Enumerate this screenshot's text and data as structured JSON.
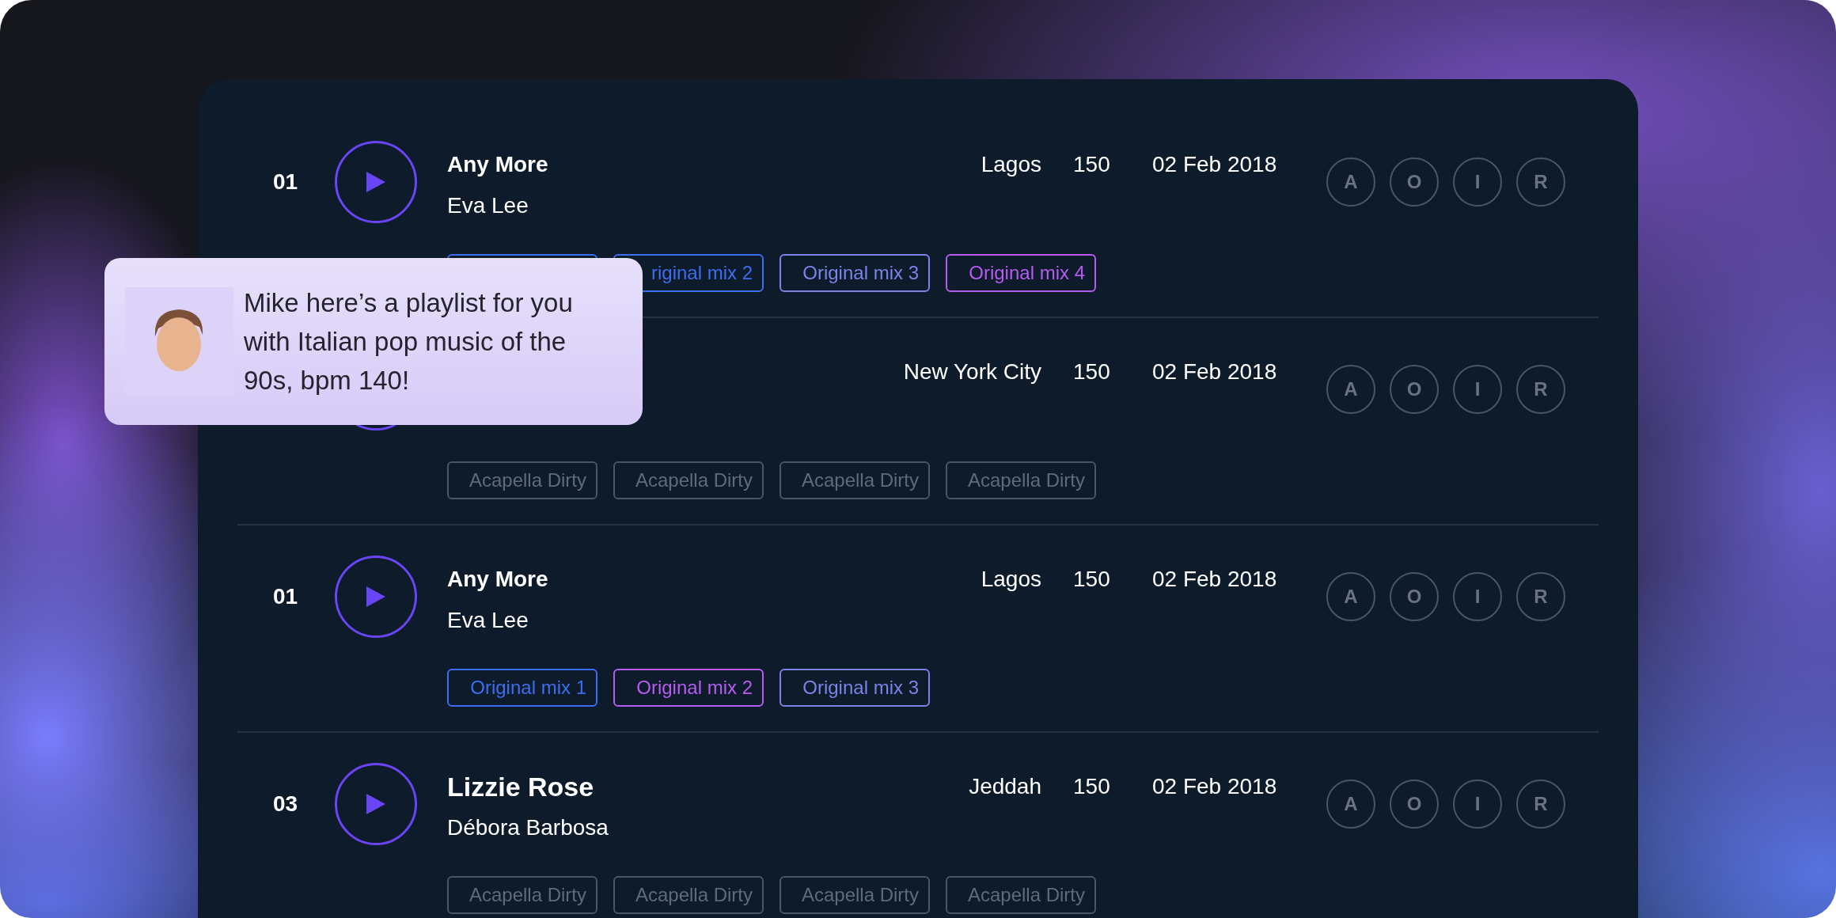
{
  "tracks": [
    {
      "kind": "regular",
      "number": "01",
      "title": "Any More",
      "artist": "Eva Lee",
      "location": "Lagos",
      "bpm": "150",
      "date": "02 Feb 2018",
      "badges": [
        "A",
        "O",
        "I",
        "R"
      ],
      "tags": [
        {
          "color": "#3b6ef0"
        },
        {
          "label": "riginal mix 2",
          "color": "#3b6ef0"
        },
        {
          "label": "Original mix 3",
          "color": "#7b83e8"
        },
        {
          "label": "Original mix 4",
          "color": "#b65cf0"
        }
      ]
    },
    {
      "location": "New York City",
      "bpm": "150",
      "date": "02 Feb 2018",
      "badges": [
        "A",
        "O",
        "I",
        "R"
      ],
      "tags": [
        {
          "label": "Acapella Dirty",
          "color": "#4b5563"
        },
        {
          "label": "Acapella Dirty",
          "color": "#4b5563"
        },
        {
          "label": "Acapella Dirty",
          "color": "#4b5563"
        },
        {
          "label": "Acapella Dirty",
          "color": "#4b5563"
        }
      ]
    },
    {
      "kind": "regular",
      "number": "01",
      "title": "Any More",
      "artist": "Eva Lee",
      "location": "Lagos",
      "bpm": "150",
      "date": "02 Feb 2018",
      "badges": [
        "A",
        "O",
        "I",
        "R"
      ],
      "tags": [
        {
          "label": "Original mix 1",
          "color": "#3b6ef0"
        },
        {
          "label": "Original mix 2",
          "color": "#b65cf0"
        },
        {
          "label": "Original mix 3",
          "color": "#7b83e8"
        }
      ]
    },
    {
      "kind": "large",
      "number": "03",
      "title": "Lizzie Rose",
      "artist": "Débora Barbosa",
      "location": "Jeddah",
      "bpm": "150",
      "date": "02 Feb 2018",
      "badges": [
        "A",
        "O",
        "I",
        "R"
      ],
      "tags": [
        {
          "label": "Acapella Dirty",
          "color": "#4b5563"
        },
        {
          "label": "Acapella Dirty",
          "color": "#4b5563"
        },
        {
          "label": "Acapella Dirty",
          "color": "#4b5563"
        },
        {
          "label": "Acapella Dirty",
          "color": "#4b5563"
        }
      ]
    }
  ],
  "message": {
    "text": "Mike here’s a playlist for you with Italian pop music of the 90s, bpm 140!"
  }
}
